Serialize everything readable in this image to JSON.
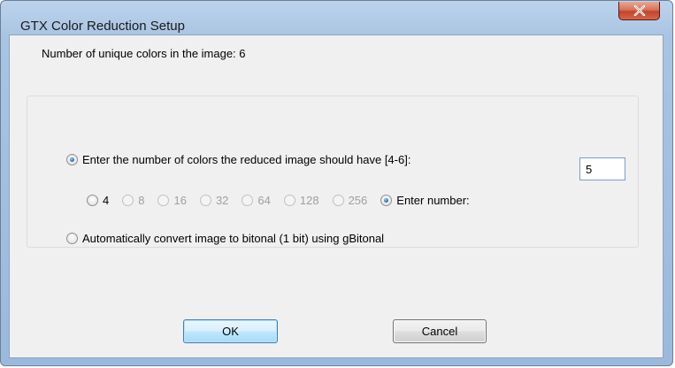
{
  "window": {
    "title": "GTX Color Reduction Setup"
  },
  "info": {
    "unique_colors_label": "Number of unique colors in the image: 6"
  },
  "options": {
    "enter_count_label": "Enter the number of colors the reduced image should have [4-6]:",
    "enter_count_selected": true,
    "color_choices": [
      {
        "label": "4",
        "enabled": true,
        "selected": false
      },
      {
        "label": "8",
        "enabled": false,
        "selected": false
      },
      {
        "label": "16",
        "enabled": false,
        "selected": false
      },
      {
        "label": "32",
        "enabled": false,
        "selected": false
      },
      {
        "label": "64",
        "enabled": false,
        "selected": false
      },
      {
        "label": "128",
        "enabled": false,
        "selected": false
      },
      {
        "label": "256",
        "enabled": false,
        "selected": false
      }
    ],
    "enter_number_label": "Enter number:",
    "enter_number_selected": true,
    "enter_number_value": "5",
    "bitonal_label": "Automatically convert image to bitonal (1 bit) using gBitonal",
    "bitonal_selected": false
  },
  "buttons": {
    "ok_label": "OK",
    "cancel_label": "Cancel"
  },
  "icons": {
    "close": "close-icon"
  }
}
